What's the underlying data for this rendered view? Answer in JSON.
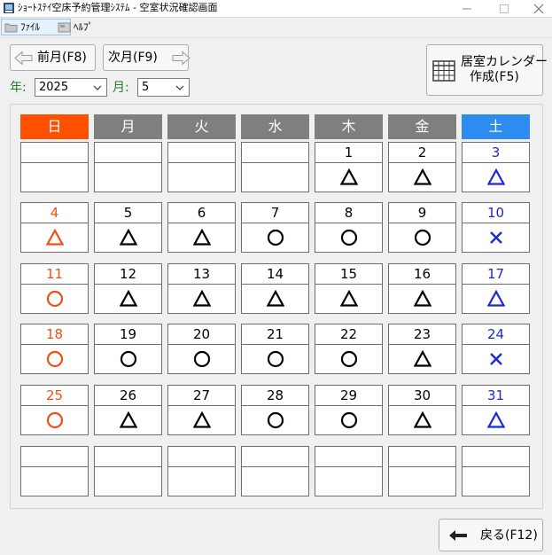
{
  "window": {
    "title": "ｼｮｰﾄｽﾃｲ空床予約管理ｼｽﾃﾑ - 空室状況確認画面"
  },
  "menu": {
    "file_label": "ﾌｧｲﾙ",
    "help_label": "ﾍﾙﾌﾟ"
  },
  "toolbar": {
    "prev_label": "前月(F8)",
    "next_label": "次月(F9)",
    "calendar_line1": "居室カレンダー",
    "calendar_line2": "作成(F5)",
    "back_label": "戻る(F12)"
  },
  "filters": {
    "year_label": "年:",
    "year_value": "2025",
    "month_label": "月:",
    "month_value": "5"
  },
  "calendar": {
    "weekdays": [
      "日",
      "月",
      "火",
      "水",
      "木",
      "金",
      "土"
    ],
    "colors": {
      "sunday_header": "#ff5000",
      "saturday_header": "#2e8cf0",
      "weekday_header": "#7f7f7f",
      "sunday_text": "#f05014",
      "saturday_text": "#1e28d2",
      "weekday_text": "#000000"
    },
    "weeks": [
      [
        {
          "day": "",
          "status": ""
        },
        {
          "day": "",
          "status": ""
        },
        {
          "day": "",
          "status": ""
        },
        {
          "day": "",
          "status": ""
        },
        {
          "day": "1",
          "status": "triangle"
        },
        {
          "day": "2",
          "status": "triangle"
        },
        {
          "day": "3",
          "status": "triangle"
        }
      ],
      [
        {
          "day": "4",
          "status": "triangle"
        },
        {
          "day": "5",
          "status": "triangle"
        },
        {
          "day": "6",
          "status": "triangle"
        },
        {
          "day": "7",
          "status": "circle"
        },
        {
          "day": "8",
          "status": "circle"
        },
        {
          "day": "9",
          "status": "circle"
        },
        {
          "day": "10",
          "status": "cross"
        }
      ],
      [
        {
          "day": "11",
          "status": "circle"
        },
        {
          "day": "12",
          "status": "triangle"
        },
        {
          "day": "13",
          "status": "triangle"
        },
        {
          "day": "14",
          "status": "triangle"
        },
        {
          "day": "15",
          "status": "triangle"
        },
        {
          "day": "16",
          "status": "triangle"
        },
        {
          "day": "17",
          "status": "triangle"
        }
      ],
      [
        {
          "day": "18",
          "status": "circle"
        },
        {
          "day": "19",
          "status": "circle"
        },
        {
          "day": "20",
          "status": "circle"
        },
        {
          "day": "21",
          "status": "circle"
        },
        {
          "day": "22",
          "status": "circle"
        },
        {
          "day": "23",
          "status": "triangle"
        },
        {
          "day": "24",
          "status": "cross"
        }
      ],
      [
        {
          "day": "25",
          "status": "circle"
        },
        {
          "day": "26",
          "status": "triangle"
        },
        {
          "day": "27",
          "status": "triangle"
        },
        {
          "day": "28",
          "status": "circle"
        },
        {
          "day": "29",
          "status": "circle"
        },
        {
          "day": "30",
          "status": "triangle"
        },
        {
          "day": "31",
          "status": "triangle"
        }
      ],
      [
        {
          "day": "",
          "status": ""
        },
        {
          "day": "",
          "status": ""
        },
        {
          "day": "",
          "status": ""
        },
        {
          "day": "",
          "status": ""
        },
        {
          "day": "",
          "status": ""
        },
        {
          "day": "",
          "status": ""
        },
        {
          "day": "",
          "status": ""
        }
      ]
    ]
  }
}
